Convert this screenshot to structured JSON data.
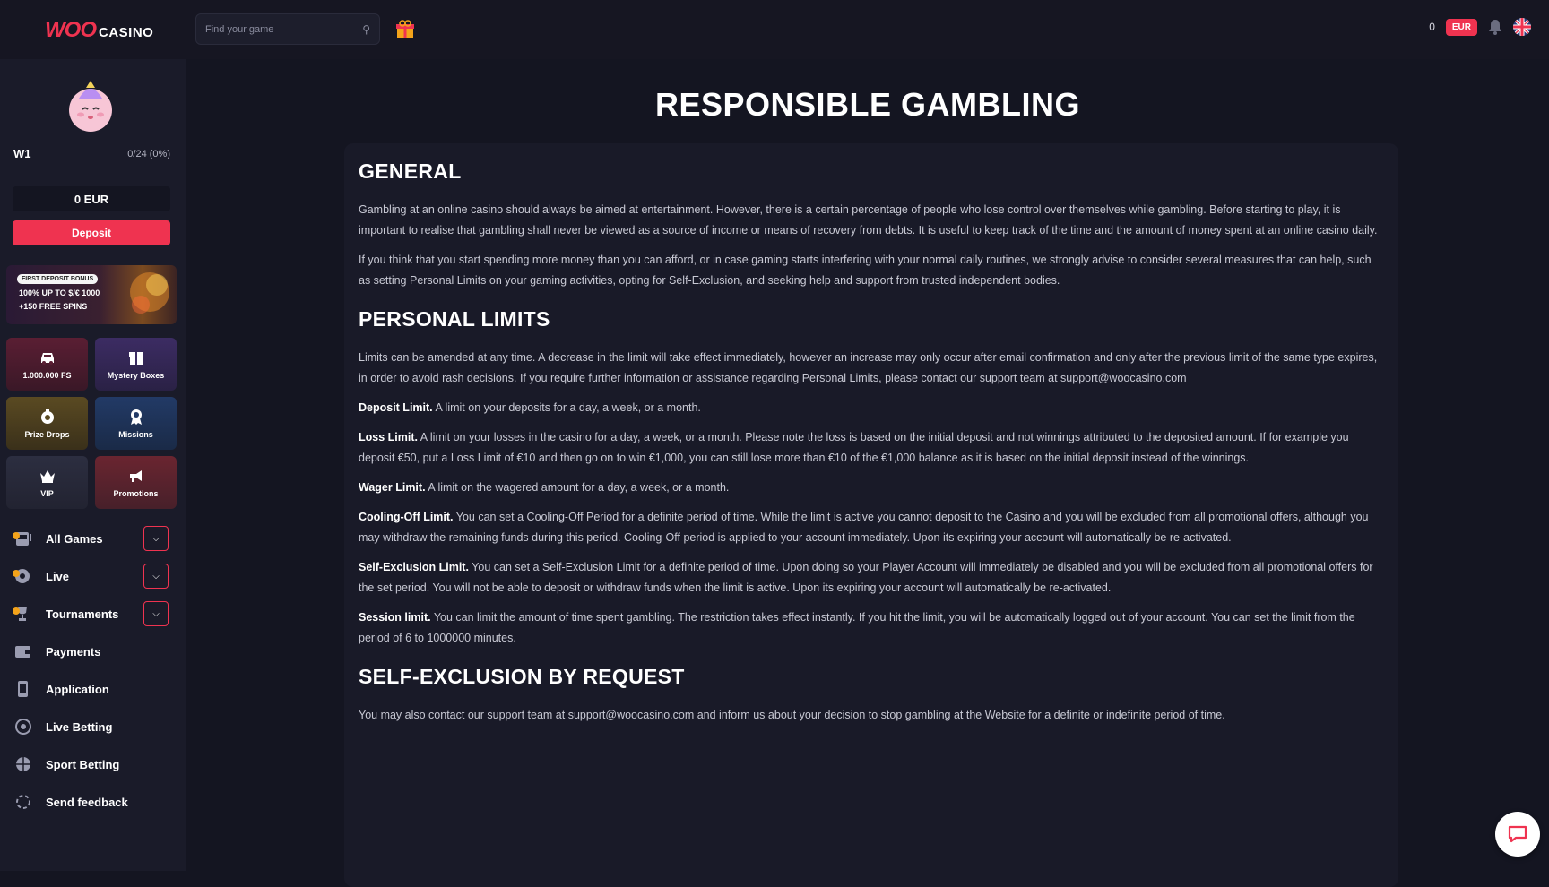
{
  "header": {
    "logo_woo": "WOO",
    "logo_casino": "CASINO",
    "search_placeholder": "Find your game",
    "balance": "0",
    "currency": "EUR"
  },
  "sidebar": {
    "level": "W1",
    "progress": "0/24 (0%)",
    "balance_display": "0 EUR",
    "deposit_label": "Deposit",
    "promo": {
      "tag": "FIRST DEPOSIT BONUS",
      "line1": "100% UP TO $/€ 1000",
      "line2": "+150 FREE SPINS"
    },
    "tiles": [
      {
        "label": "1.000.000 FS",
        "icon": "car-icon"
      },
      {
        "label": "Mystery Boxes",
        "icon": "box-icon"
      },
      {
        "label": "Prize Drops",
        "icon": "prize-drop-icon"
      },
      {
        "label": "Missions",
        "icon": "medal-icon"
      },
      {
        "label": "VIP",
        "icon": "crown-icon"
      },
      {
        "label": "Promotions",
        "icon": "megaphone-icon"
      }
    ],
    "nav": [
      {
        "label": "All Games",
        "icon": "slot-machine-icon",
        "expandable": true,
        "badge": true
      },
      {
        "label": "Live",
        "icon": "roulette-icon",
        "expandable": true,
        "badge": true
      },
      {
        "label": "Tournaments",
        "icon": "trophy-icon",
        "expandable": true,
        "badge": true
      },
      {
        "label": "Payments",
        "icon": "wallet-icon",
        "expandable": false
      },
      {
        "label": "Application",
        "icon": "phone-icon",
        "expandable": false
      },
      {
        "label": "Live Betting",
        "icon": "live-icon",
        "expandable": false
      },
      {
        "label": "Sport Betting",
        "icon": "ball-icon",
        "expandable": false
      },
      {
        "label": "Send feedback",
        "icon": "feedback-icon",
        "expandable": false
      }
    ]
  },
  "main": {
    "title": "RESPONSIBLE GAMBLING",
    "general": {
      "heading": "GENERAL",
      "p1": "Gambling at an online casino should always be aimed at entertainment. However, there is a certain percentage of people who lose control over themselves while gambling. Before starting to play, it is important to realise that gambling shall never be viewed as a source of income or means of recovery from debts. It is useful to keep track of the time and the amount of money spent at an online casino daily.",
      "p2": "If you think that you start spending more money than you can afford, or in case gaming starts interfering with your normal daily routines, we strongly advise to consider several measures that can help, such as setting Personal Limits on your gaming activities, opting for Self-Exclusion, and seeking help and support from trusted independent bodies."
    },
    "limits": {
      "heading": "PERSONAL LIMITS",
      "intro": "Limits can be amended at any time. A decrease in the limit will take effect immediately, however an increase may only occur after email confirmation and only after the previous limit of the same type expires, in order to avoid rash decisions. If you require further information or assistance regarding Personal Limits, please contact our support team at support@woocasino.com",
      "deposit_t": "Deposit Limit.",
      "deposit": " A limit on your deposits for a day, a week, or a month.",
      "loss_t": "Loss Limit.",
      "loss": " A limit on your losses in the casino for a day, a week, or a month. Please note the loss is based on the initial deposit and not winnings attributed to the deposited amount. If for example you deposit €50, put a Loss Limit of €10 and then go on to win €1,000, you can still lose more than €10 of the €1,000 balance as it is based on the initial deposit instead of the winnings.",
      "wager_t": "Wager Limit.",
      "wager": " A limit on the wagered amount for a day, a week, or a month.",
      "cooling_t": "Cooling-Off Limit.",
      "cooling": " You can set a Cooling-Off Period for a definite period of time. While the limit is active you cannot deposit to the Casino and you will be excluded from all promotional offers, although you may withdraw the remaining funds during this period. Cooling-Off period is applied to your account immediately. Upon its expiring your account will automatically be re-activated.",
      "selfex_t": "Self-Exclusion Limit.",
      "selfex": " You can set a Self-Exclusion Limit for a definite period of time. Upon doing so your Player Account will immediately be disabled and you will be excluded from all promotional offers for the set period. You will not be able to deposit or withdraw funds when the limit is active. Upon its expiring your account will automatically be re-activated.",
      "session_t": "Session limit.",
      "session": " You can limit the amount of time spent gambling. The restriction takes effect instantly. If you hit the limit, you will be automatically logged out of your account. You can set the limit from the period of 6 to 1000000 minutes."
    },
    "selfexclusion": {
      "heading": "SELF-EXCLUSION BY REQUEST",
      "p1": "You may also contact our support team at support@woocasino.com and inform us about your decision to stop gambling at the Website for a definite or indefinite period of time."
    }
  },
  "colors": {
    "accent": "#ef3350",
    "background": "#141521",
    "sidebar": "#1a1b29",
    "card": "#191a28"
  }
}
